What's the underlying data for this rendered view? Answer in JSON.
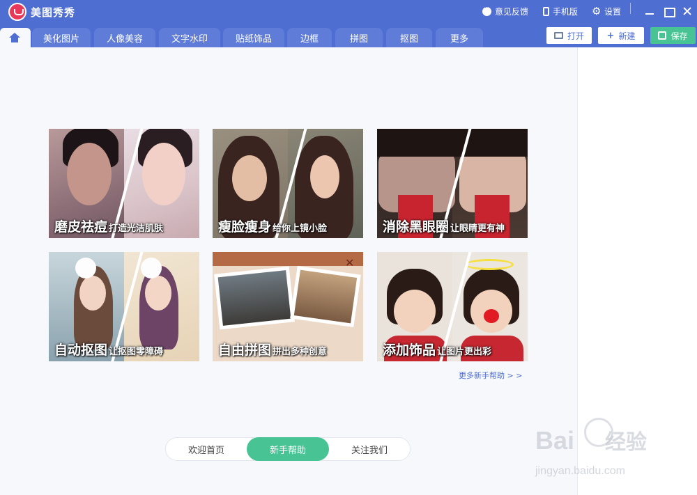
{
  "app": {
    "title": "美图秀秀"
  },
  "titlebar": {
    "feedback_label": "意见反馈",
    "mobile_label": "手机版",
    "settings_label": "设置"
  },
  "tabs": [
    {
      "label": "美化图片"
    },
    {
      "label": "人像美容"
    },
    {
      "label": "文字水印"
    },
    {
      "label": "贴纸饰品"
    },
    {
      "label": "边框"
    },
    {
      "label": "拼图"
    },
    {
      "label": "抠图"
    },
    {
      "label": "更多"
    }
  ],
  "actions": {
    "open_label": "打开",
    "new_label": "新建",
    "save_label": "保存"
  },
  "cards": [
    {
      "title": "磨皮祛痘",
      "subtitle": "打造光洁肌肤"
    },
    {
      "title": "瘦脸瘦身",
      "subtitle": "给你上镜小脸"
    },
    {
      "title": "消除黑眼圈",
      "subtitle": "让眼睛更有神"
    },
    {
      "title": "自动抠图",
      "subtitle": "让抠图零障碍"
    },
    {
      "title": "自由拼图",
      "subtitle": "拼出多种创意"
    },
    {
      "title": "添加饰品",
      "subtitle": "让图片更出彩"
    }
  ],
  "more_help_link": "更多新手帮助 > >",
  "switcher": {
    "items": [
      {
        "label": "欢迎首页"
      },
      {
        "label": "新手帮助"
      },
      {
        "label": "关注我们"
      }
    ],
    "active_index": 1
  },
  "watermark": {
    "main": "Bai",
    "brand": "经验",
    "sub": "jingyan.baidu.com"
  },
  "colors": {
    "primary": "#4f6ed1",
    "accent_green": "#48c494",
    "background": "#f6f8fc"
  }
}
